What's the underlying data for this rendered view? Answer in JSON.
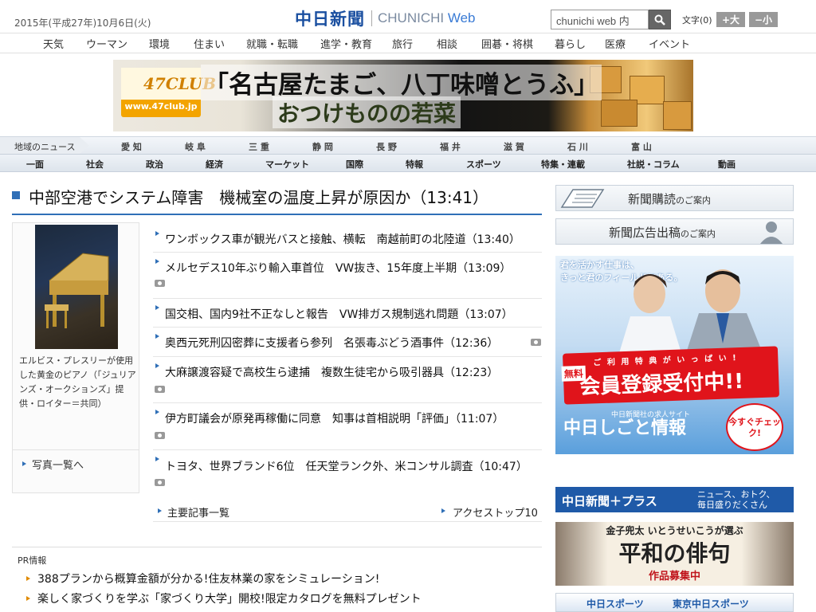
{
  "header": {
    "date": "2015年(平成27年)10月6日(火)",
    "logo_jp": "中日新聞",
    "logo_en_prefix": "CHUNICHI",
    "logo_en_suffix": "Web",
    "search_placeholder": "chunichi web 内",
    "fontsize_label": "文字(0)",
    "font_plus": "+大",
    "font_minus": "−小"
  },
  "global_nav": [
    "天気",
    "ウーマン",
    "環境",
    "住まい",
    "就職・転職",
    "進学・教育",
    "旅行",
    "相談",
    "囲碁・将棋",
    "暮らし",
    "医療",
    "イベント"
  ],
  "banner": {
    "logo": "47CLUB",
    "url": "www.47club.jp",
    "title": "「名古屋たまご、八丁味噌とうふ」",
    "subtitle": "おつけものの若菜"
  },
  "region_nav": {
    "label": "地域のニュース",
    "items": [
      "愛 知",
      "岐 阜",
      "三 重",
      "静 岡",
      "長 野",
      "福 井",
      "滋 賀",
      "石 川",
      "富 山"
    ]
  },
  "category_nav": [
    "一面",
    "社会",
    "政治",
    "経済",
    "マーケット",
    "国際",
    "特報",
    "スポーツ",
    "特集・連載",
    "社説・コラム",
    "動画"
  ],
  "top_story": "中部空港でシステム障害　機械室の温度上昇が原因か（13:41）",
  "photo": {
    "caption": "エルビス・プレスリーが使用した黄金のピアノ（「ジュリアンズ・オークションズ」提供・ロイター＝共同）",
    "more": "写真一覧へ"
  },
  "news": [
    {
      "title": "ワンボックス車が観光バスと接触、横転　南越前町の北陸道（13:40）",
      "photo": false
    },
    {
      "title": "メルセデス10年ぶり輸入車首位　VW抜き、15年度上半期（13:09）",
      "photo": true
    },
    {
      "title": "国交相、国内9社不正なしと報告　VW排ガス規制逃れ問題（13:07）",
      "photo": false
    },
    {
      "title": "奥西元死刑囚密葬に支援者ら参列　名張毒ぶどう酒事件（12:36）",
      "photo": true
    },
    {
      "title": "大麻譲渡容疑で高校生ら逮捕　複数生徒宅から吸引器具（12:23）",
      "photo": true
    },
    {
      "title": "伊方町議会が原発再稼働に同意　知事は首相説明「評価」（11:07）",
      "photo": true
    },
    {
      "title": "トヨタ、世界ブランド6位　任天堂ランク外、米コンサル調査（10:47）",
      "photo": true
    }
  ],
  "news_footer": {
    "all": "主要記事一覧",
    "access": "アクセストップ10"
  },
  "pr": {
    "heading": "PR情報",
    "items": [
      "388プランから概算金額が分かる!住友林業の家をシミュレーション!",
      "楽しく家づくりを学ぶ「家づくり大学」開校!限定カタログを無料プレゼント"
    ]
  },
  "sidebar": {
    "subscribe": "新聞購読",
    "subscribe_suffix": "のご案内",
    "advert": "新聞広告出稿",
    "advert_suffix": "のご案内",
    "job_ad": {
      "copy1": "君を活かす仕事は、",
      "copy2": "きっと君のフィールドにある。",
      "free": "無料",
      "tokuten": "ご 利 用 特 典 が い っ ぱ い !",
      "main": "会員登録受付中!!",
      "logo": "中日しごと情報",
      "small": "中日新聞社の求人サイト",
      "check": "今すぐチェック!"
    },
    "plus": {
      "logo": "中日新聞＋プラス",
      "line1": "ニュース、おトク、",
      "line2": "毎日盛りだくさん"
    },
    "haiku": {
      "sub": "金子兜太 いとうせいこうが選ぶ",
      "title": "平和の俳句",
      "cta": "作品募集中"
    },
    "sports": {
      "a": "中日スポーツ",
      "b": "東京中日スポーツ"
    }
  },
  "colors": {
    "brand": "#1a4fa0",
    "accent": "#2f6fb7",
    "red": "#e0141b"
  }
}
